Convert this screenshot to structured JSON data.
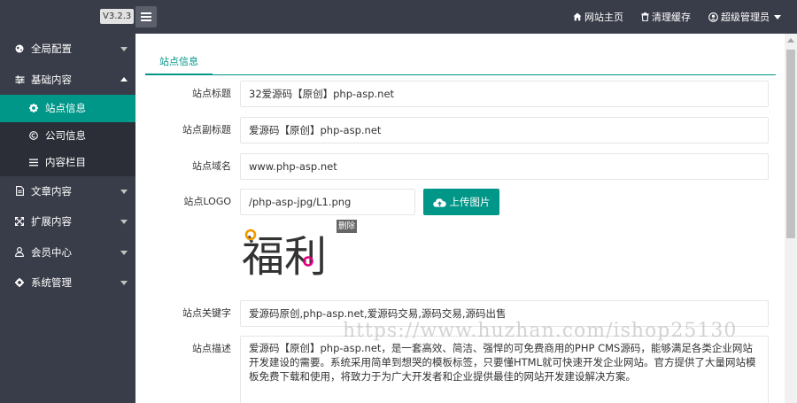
{
  "header": {
    "version": "V3.2.3",
    "nav": [
      {
        "label": "网站主页",
        "icon": "home-icon"
      },
      {
        "label": "清理缓存",
        "icon": "trash-icon"
      },
      {
        "label": "超级管理员",
        "icon": "user-circle-icon"
      }
    ]
  },
  "sidebar": {
    "items": [
      {
        "label": "全局配置",
        "icon": "globe-icon",
        "expanded": false
      },
      {
        "label": "基础内容",
        "icon": "sliders-icon",
        "expanded": true,
        "children": [
          {
            "label": "站点信息",
            "icon": "gear-icon",
            "active": true
          },
          {
            "label": "公司信息",
            "icon": "copyright-icon",
            "active": false
          },
          {
            "label": "内容栏目",
            "icon": "list-icon",
            "active": false
          }
        ]
      },
      {
        "label": "文章内容",
        "icon": "file-icon",
        "expanded": false
      },
      {
        "label": "扩展内容",
        "icon": "expand-icon",
        "expanded": false
      },
      {
        "label": "会员中心",
        "icon": "user-icon",
        "expanded": false
      },
      {
        "label": "系统管理",
        "icon": "cog-icon",
        "expanded": false
      }
    ]
  },
  "main": {
    "tab": "站点信息",
    "fields": {
      "title": {
        "label": "站点标题",
        "value": "32爱源码【原创】php-asp.net"
      },
      "subtitle": {
        "label": "站点副标题",
        "value": "爱源码【原创】php-asp.net"
      },
      "domain": {
        "label": "站点域名",
        "value": "www.php-asp.net"
      },
      "logo": {
        "label": "站点LOGO",
        "value": "/php-asp-jpg/L1.png",
        "upload_label": "上传图片",
        "delete_label": "删除",
        "preview_text": "福利"
      },
      "keywords": {
        "label": "站点关键字",
        "value": "爱源码原创,php-asp.net,爱源码交易,源码交易,源码出售"
      },
      "description": {
        "label": "站点描述",
        "value": "爱源码【原创】php-asp.net，是一套高效、简洁、强悍的可免费商用的PHP CMS源码，能够满足各类企业网站开发建设的需要。系统采用简单到想哭的模板标签，只要懂HTML就可快速开发企业网站。官方提供了大量网站模板免费下载和使用，将致力于为广大开发者和企业提供最佳的网站开发建设解决方案。"
      }
    }
  },
  "watermark": "https://www.huzhan.com/ishop25130",
  "colors": {
    "accent": "#009688",
    "sidebar_bg": "#393d49",
    "subnav_bg": "#2b2e37"
  }
}
